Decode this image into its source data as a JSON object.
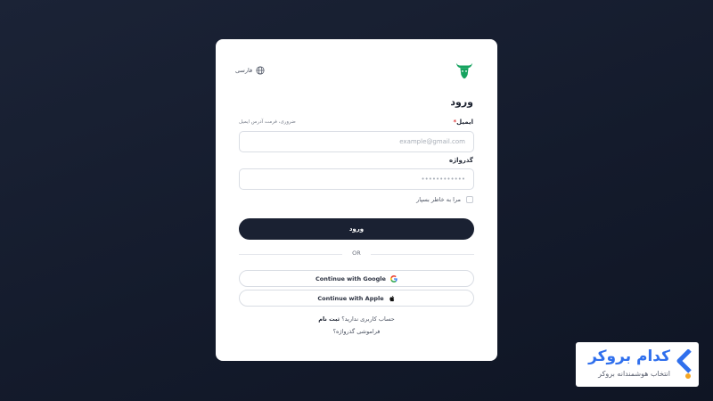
{
  "lang_switch": {
    "label": "فارسی"
  },
  "login": {
    "title": "ورود",
    "email_label": "ایمیل",
    "email_required_mark": "*",
    "email_hint": "ضروری، فرمت آدرس ایمیل",
    "email_placeholder": "example@gmail.com",
    "email_value": "",
    "password_label": "گذرواژه",
    "password_placeholder": "••••••••••••",
    "remember_label": "مرا به خاطر بسپار",
    "submit_label": "ورود",
    "or_text": "OR",
    "google_label": "Continue with Google",
    "apple_label": "Continue with Apple",
    "signup_prompt": "حساب کاربری ندارید؟",
    "signup_link": "ثبت نام",
    "forgot_label": "فراموشی گذرواژه؟"
  },
  "watermark": {
    "name": "کدام بروکر",
    "tagline": "انتخاب هوشمندانه بروکر"
  },
  "colors": {
    "logo_green": "#16a35f",
    "button_dark": "#1a2132",
    "brand_blue": "#2f6fed",
    "brand_orange": "#f5a623"
  },
  "icons": {
    "lang": "globe-icon",
    "logo": "bull-logo-icon",
    "google": "google-icon",
    "apple": "apple-icon"
  }
}
